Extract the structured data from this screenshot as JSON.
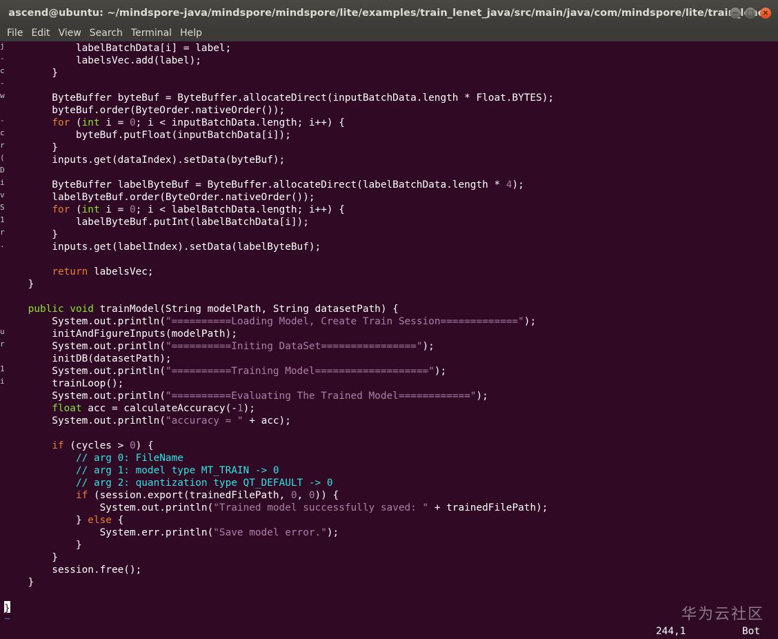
{
  "window": {
    "title": "ascend@ubuntu: ~/mindspore-java/mindspore/mindspore/lite/examples/train_lenet_java/src/main/java/com/mindspore/lite/train_lenet",
    "buttons": {
      "minimize": "−",
      "maximize": "□",
      "close": "×"
    }
  },
  "menu": [
    "File",
    "Edit",
    "View",
    "Search",
    "Terminal",
    "Help"
  ],
  "code": [
    [
      [
        "            labelBatchData[i] = label;",
        ""
      ]
    ],
    [
      [
        "            labelsVec.add(label);",
        ""
      ]
    ],
    [
      [
        "        }",
        ""
      ]
    ],
    [
      [
        "",
        ""
      ]
    ],
    [
      [
        "        ByteBuffer byteBuf = ByteBuffer.allocateDirect(inputBatchData.length * Float.BYTES);",
        ""
      ]
    ],
    [
      [
        "        byteBuf.order(ByteOrder.nativeOrder());",
        ""
      ]
    ],
    [
      [
        "        ",
        ""
      ],
      [
        "for",
        "kw"
      ],
      [
        " (",
        ""
      ],
      [
        "int",
        "type"
      ],
      [
        " i = ",
        ""
      ],
      [
        "0",
        "num"
      ],
      [
        "; i < inputBatchData.length; i++) {",
        ""
      ]
    ],
    [
      [
        "            byteBuf.putFloat(inputBatchData[i]);",
        ""
      ]
    ],
    [
      [
        "        }",
        ""
      ]
    ],
    [
      [
        "        inputs.get(dataIndex).setData(byteBuf);",
        ""
      ]
    ],
    [
      [
        "",
        ""
      ]
    ],
    [
      [
        "        ByteBuffer labelByteBuf = ByteBuffer.allocateDirect(labelBatchData.length * ",
        ""
      ],
      [
        "4",
        "num"
      ],
      [
        ");",
        ""
      ]
    ],
    [
      [
        "        labelByteBuf.order(ByteOrder.nativeOrder());",
        ""
      ]
    ],
    [
      [
        "        ",
        ""
      ],
      [
        "for",
        "kw"
      ],
      [
        " (",
        ""
      ],
      [
        "int",
        "type"
      ],
      [
        " i = ",
        ""
      ],
      [
        "0",
        "num"
      ],
      [
        "; i < labelBatchData.length; i++) {",
        ""
      ]
    ],
    [
      [
        "            labelByteBuf.putInt(labelBatchData[i]);",
        ""
      ]
    ],
    [
      [
        "        }",
        ""
      ]
    ],
    [
      [
        "        inputs.get(labelIndex).setData(labelByteBuf);",
        ""
      ]
    ],
    [
      [
        "",
        ""
      ]
    ],
    [
      [
        "        ",
        ""
      ],
      [
        "return",
        "kw"
      ],
      [
        " labelsVec;",
        ""
      ]
    ],
    [
      [
        "    }",
        ""
      ]
    ],
    [
      [
        "",
        ""
      ]
    ],
    [
      [
        "    ",
        ""
      ],
      [
        "public",
        "type"
      ],
      [
        " ",
        ""
      ],
      [
        "void",
        "type"
      ],
      [
        " trainModel(String modelPath, String datasetPath) {",
        ""
      ]
    ],
    [
      [
        "        System.out.println(",
        ""
      ],
      [
        "\"==========Loading Model, Create Train Session=============\"",
        "str"
      ],
      [
        ");",
        ""
      ]
    ],
    [
      [
        "        initAndFigureInputs(modelPath);",
        ""
      ]
    ],
    [
      [
        "        System.out.println(",
        ""
      ],
      [
        "\"==========Initing DataSet================\"",
        "str"
      ],
      [
        ");",
        ""
      ]
    ],
    [
      [
        "        initDB(datasetPath);",
        ""
      ]
    ],
    [
      [
        "        System.out.println(",
        ""
      ],
      [
        "\"==========Training Model===================\"",
        "str"
      ],
      [
        ");",
        ""
      ]
    ],
    [
      [
        "        trainLoop();",
        ""
      ]
    ],
    [
      [
        "        System.out.println(",
        ""
      ],
      [
        "\"==========Evaluating The Trained Model============\"",
        "str"
      ],
      [
        ");",
        ""
      ]
    ],
    [
      [
        "        ",
        ""
      ],
      [
        "float",
        "type"
      ],
      [
        " acc = calculateAccuracy(-",
        ""
      ],
      [
        "1",
        "num"
      ],
      [
        ");",
        ""
      ]
    ],
    [
      [
        "        System.out.println(",
        ""
      ],
      [
        "\"accuracy = \"",
        "str"
      ],
      [
        " + acc);",
        ""
      ]
    ],
    [
      [
        "",
        ""
      ]
    ],
    [
      [
        "        ",
        ""
      ],
      [
        "if",
        "kw"
      ],
      [
        " (cycles > ",
        ""
      ],
      [
        "0",
        "num"
      ],
      [
        ") {",
        ""
      ]
    ],
    [
      [
        "            ",
        ""
      ],
      [
        "// arg 0: FileName",
        "cmt"
      ]
    ],
    [
      [
        "            ",
        ""
      ],
      [
        "// arg 1: model type MT_TRAIN -> 0",
        "cmt"
      ]
    ],
    [
      [
        "            ",
        ""
      ],
      [
        "// arg 2: quantization type QT_DEFAULT -> 0",
        "cmt"
      ]
    ],
    [
      [
        "            ",
        ""
      ],
      [
        "if",
        "kw"
      ],
      [
        " (session.export(trainedFilePath, ",
        ""
      ],
      [
        "0",
        "num"
      ],
      [
        ", ",
        ""
      ],
      [
        "0",
        "num"
      ],
      [
        ")) {",
        ""
      ]
    ],
    [
      [
        "                System.out.println(",
        ""
      ],
      [
        "\"Trained model successfully saved: \"",
        "str"
      ],
      [
        " + trainedFilePath);",
        ""
      ]
    ],
    [
      [
        "            } ",
        ""
      ],
      [
        "else",
        "kw"
      ],
      [
        " {",
        ""
      ]
    ],
    [
      [
        "                System.err.println(",
        ""
      ],
      [
        "\"Save model error.\"",
        "str"
      ],
      [
        ");",
        ""
      ]
    ],
    [
      [
        "            }",
        ""
      ]
    ],
    [
      [
        "        }",
        ""
      ]
    ],
    [
      [
        "        session.free();",
        ""
      ]
    ],
    [
      [
        "    }",
        ""
      ]
    ]
  ],
  "cursor_char": "}",
  "tilde": "~",
  "status": {
    "position": "244,1",
    "scroll": "Bot"
  },
  "watermark": "华为云社区",
  "left_strip_chars": [
    "j",
    "-",
    "c",
    "-",
    "w",
    "",
    "-",
    "c",
    "r",
    "(",
    "D",
    "i",
    "v",
    "S",
    "1",
    "r",
    ".",
    "",
    "u",
    "r",
    "",
    "1",
    "i"
  ]
}
